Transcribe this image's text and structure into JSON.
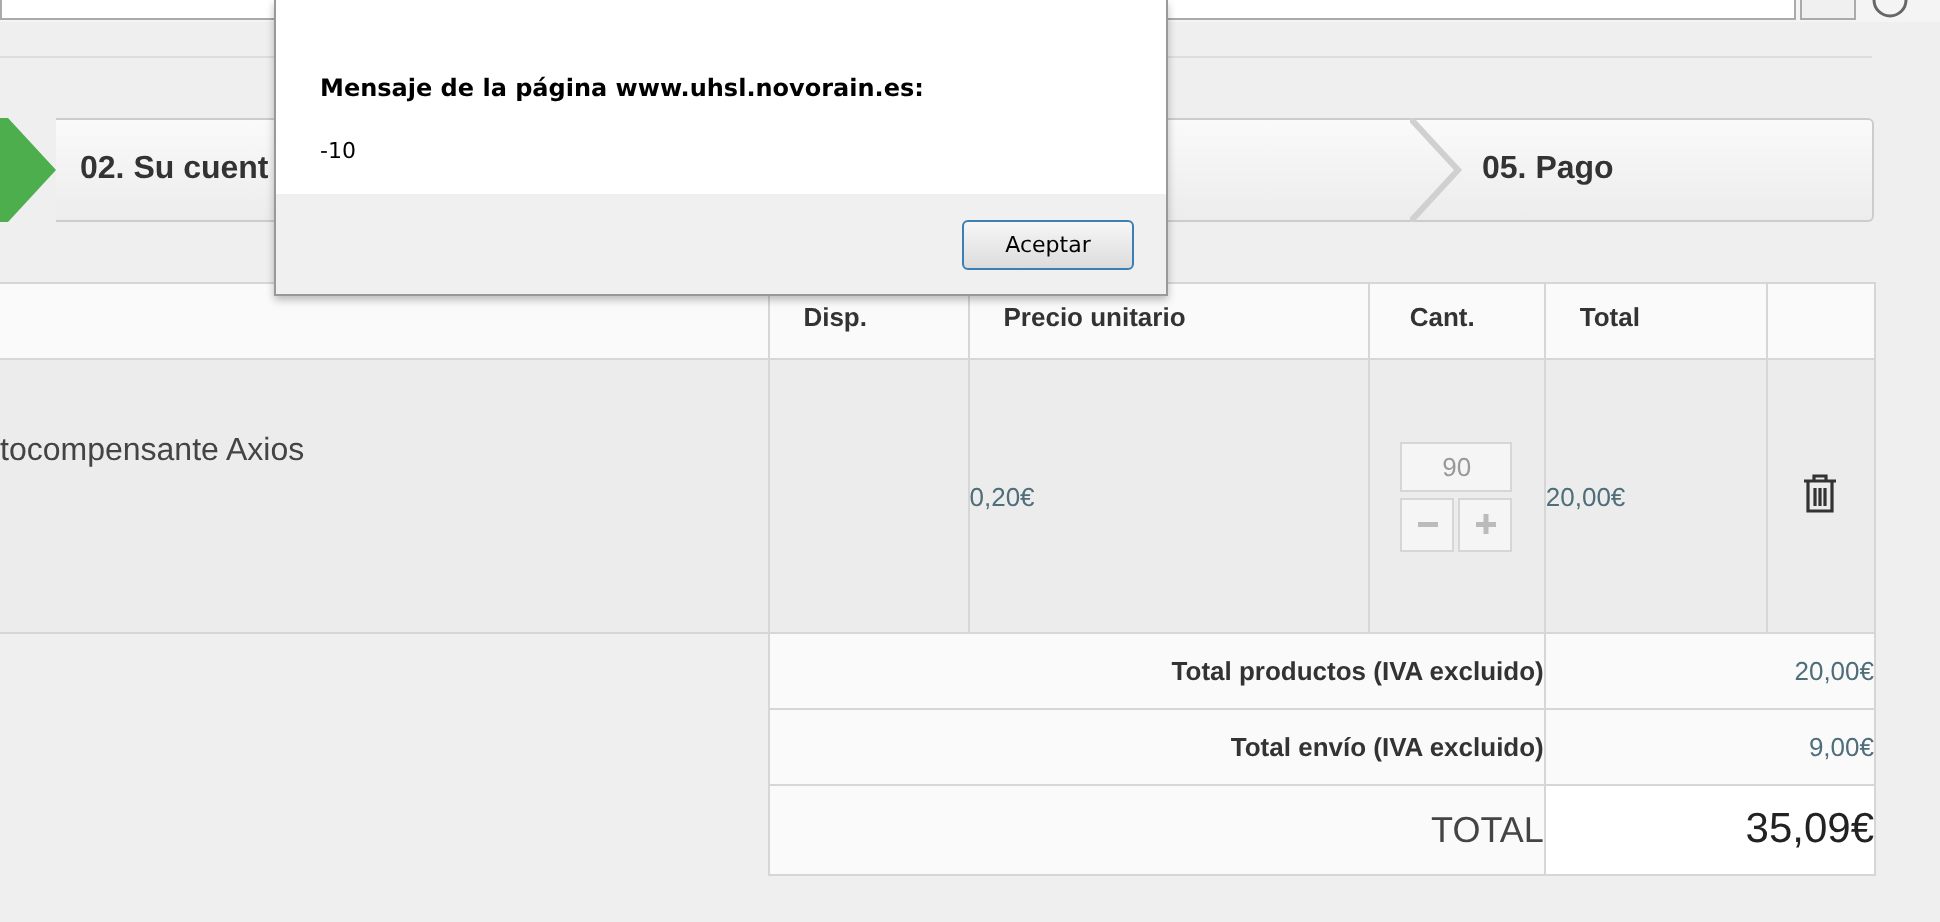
{
  "steps": {
    "previous_done": true,
    "items": [
      {
        "label": "02. Su cuent"
      },
      {
        "label": "05. Pago"
      }
    ]
  },
  "cart": {
    "columns": [
      "",
      "Disp.",
      "Precio unitario",
      "Cant.",
      "Total",
      ""
    ],
    "rows": [
      {
        "product": "tocompensante Axios",
        "availability": "",
        "unit_price": "0,20€",
        "quantity": "90",
        "total": "20,00€"
      }
    ],
    "summary": [
      {
        "kind": "line",
        "label": "Total productos (IVA excluido)",
        "value": "20,00€"
      },
      {
        "kind": "line",
        "label": "Total envío (IVA excluido)",
        "value": "9,00€"
      },
      {
        "kind": "grand",
        "label": "TOTAL",
        "value": "35,09€"
      }
    ]
  },
  "dialog": {
    "title": "Mensaje de la página www.uhsl.novorain.es:",
    "message": "-10",
    "button": "Aceptar"
  }
}
